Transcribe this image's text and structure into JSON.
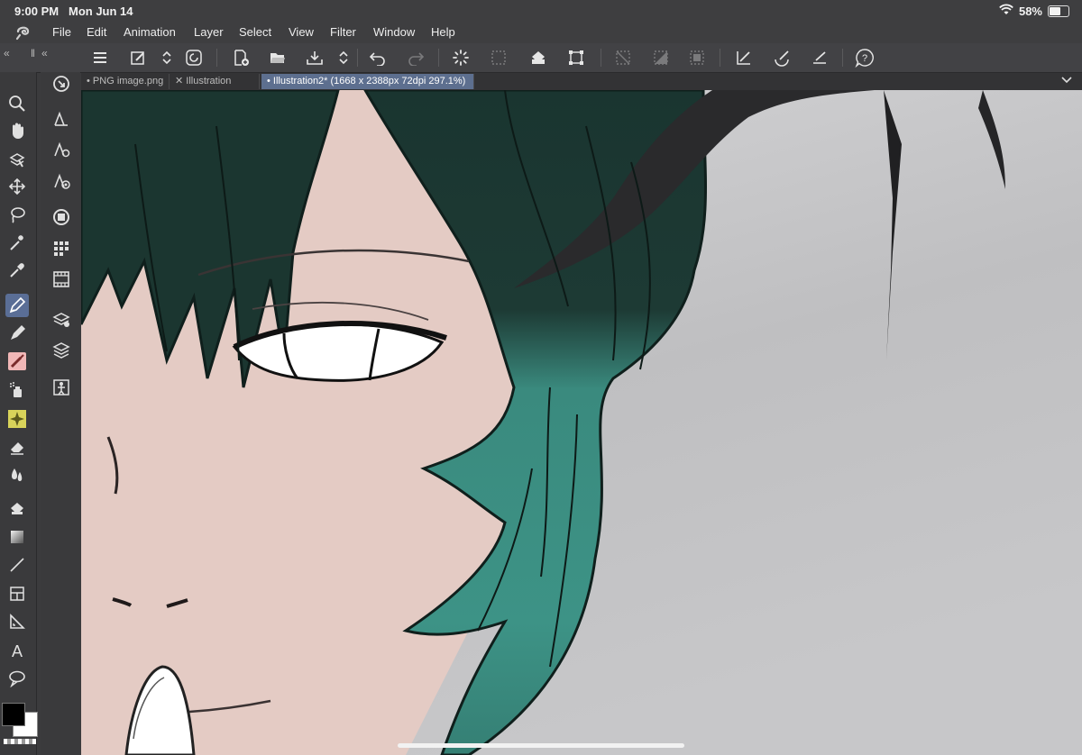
{
  "status": {
    "time": "9:00 PM",
    "date": "Mon Jun 14",
    "battery": "58%",
    "battery_level": 0.58
  },
  "menu": {
    "items": [
      "File",
      "Edit",
      "Animation",
      "Layer",
      "Select",
      "View",
      "Filter",
      "Window",
      "Help"
    ]
  },
  "tabs": [
    {
      "label": "PNG image.png",
      "marker": "•"
    },
    {
      "label": "Illustration",
      "marker": "✕"
    },
    {
      "label": "Illustration2* (1668 x 2388px 72dpi 297.1%)",
      "marker": "•"
    }
  ],
  "toolbar": {
    "collapse_left": "«",
    "divider": "‖",
    "collapse_right": "«"
  },
  "colors": {
    "accent": "#5a6e96",
    "skin": "#e4cbc4",
    "hair_dark": "#1b3630",
    "hair_teal": "#3d8f82"
  }
}
